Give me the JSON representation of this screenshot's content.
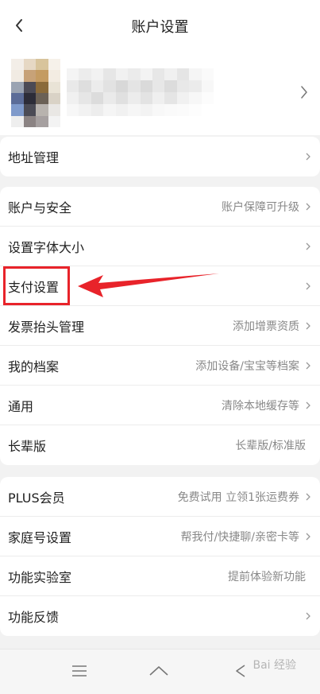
{
  "header": {
    "title": "账户设置",
    "back_icon": "chevron-left-icon"
  },
  "profile": {
    "avatar_icon": "avatar",
    "name": "",
    "arrow_icon": "chevron-right-icon"
  },
  "sections": [
    {
      "rows": [
        {
          "label": "地址管理",
          "value": ""
        }
      ]
    },
    {
      "rows": [
        {
          "label": "账户与安全",
          "value": "账户保障可升级"
        },
        {
          "label": "设置字体大小",
          "value": ""
        },
        {
          "label": "支付设置",
          "value": ""
        },
        {
          "label": "发票抬头管理",
          "value": "添加增票资质"
        },
        {
          "label": "我的档案",
          "value": "添加设备/宝宝等档案"
        },
        {
          "label": "通用",
          "value": "清除本地缓存等"
        },
        {
          "label": "长辈版",
          "value": "长辈版/标准版"
        }
      ]
    },
    {
      "rows": [
        {
          "label": "PLUS会员",
          "value": "免费试用 立领1张运费券"
        },
        {
          "label": "家庭号设置",
          "value": "帮我付/快捷聊/亲密卡等"
        },
        {
          "label": "功能实验室",
          "value": "提前体验新功能"
        },
        {
          "label": "功能反馈",
          "value": ""
        }
      ]
    }
  ],
  "annotation": {
    "highlight_color": "#e8232a"
  },
  "bottom_nav": {
    "menu_icon": "menu-icon",
    "home_icon": "home-icon",
    "back_icon": "back-icon"
  },
  "watermark": {
    "text": "Bai 经验"
  },
  "colors": {
    "background": "#f2f2f2",
    "card": "#ffffff",
    "text_primary": "#222222",
    "text_secondary": "#888888"
  }
}
